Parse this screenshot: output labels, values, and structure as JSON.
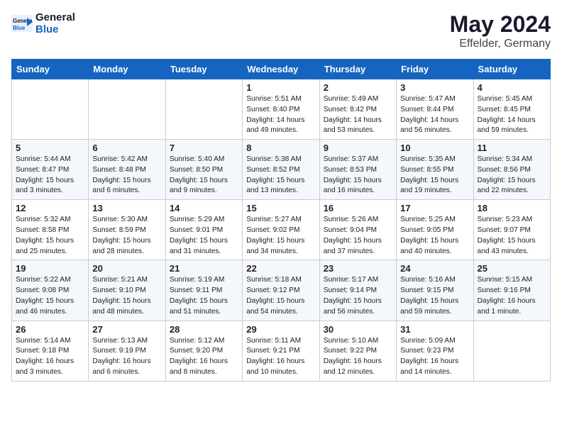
{
  "logo": {
    "line1": "General",
    "line2": "Blue"
  },
  "title": "May 2024",
  "location": "Effelder, Germany",
  "weekdays": [
    "Sunday",
    "Monday",
    "Tuesday",
    "Wednesday",
    "Thursday",
    "Friday",
    "Saturday"
  ],
  "weeks": [
    [
      {
        "day": "",
        "info": ""
      },
      {
        "day": "",
        "info": ""
      },
      {
        "day": "",
        "info": ""
      },
      {
        "day": "1",
        "info": "Sunrise: 5:51 AM\nSunset: 8:40 PM\nDaylight: 14 hours\nand 49 minutes."
      },
      {
        "day": "2",
        "info": "Sunrise: 5:49 AM\nSunset: 8:42 PM\nDaylight: 14 hours\nand 53 minutes."
      },
      {
        "day": "3",
        "info": "Sunrise: 5:47 AM\nSunset: 8:44 PM\nDaylight: 14 hours\nand 56 minutes."
      },
      {
        "day": "4",
        "info": "Sunrise: 5:45 AM\nSunset: 8:45 PM\nDaylight: 14 hours\nand 59 minutes."
      }
    ],
    [
      {
        "day": "5",
        "info": "Sunrise: 5:44 AM\nSunset: 8:47 PM\nDaylight: 15 hours\nand 3 minutes."
      },
      {
        "day": "6",
        "info": "Sunrise: 5:42 AM\nSunset: 8:48 PM\nDaylight: 15 hours\nand 6 minutes."
      },
      {
        "day": "7",
        "info": "Sunrise: 5:40 AM\nSunset: 8:50 PM\nDaylight: 15 hours\nand 9 minutes."
      },
      {
        "day": "8",
        "info": "Sunrise: 5:38 AM\nSunset: 8:52 PM\nDaylight: 15 hours\nand 13 minutes."
      },
      {
        "day": "9",
        "info": "Sunrise: 5:37 AM\nSunset: 8:53 PM\nDaylight: 15 hours\nand 16 minutes."
      },
      {
        "day": "10",
        "info": "Sunrise: 5:35 AM\nSunset: 8:55 PM\nDaylight: 15 hours\nand 19 minutes."
      },
      {
        "day": "11",
        "info": "Sunrise: 5:34 AM\nSunset: 8:56 PM\nDaylight: 15 hours\nand 22 minutes."
      }
    ],
    [
      {
        "day": "12",
        "info": "Sunrise: 5:32 AM\nSunset: 8:58 PM\nDaylight: 15 hours\nand 25 minutes."
      },
      {
        "day": "13",
        "info": "Sunrise: 5:30 AM\nSunset: 8:59 PM\nDaylight: 15 hours\nand 28 minutes."
      },
      {
        "day": "14",
        "info": "Sunrise: 5:29 AM\nSunset: 9:01 PM\nDaylight: 15 hours\nand 31 minutes."
      },
      {
        "day": "15",
        "info": "Sunrise: 5:27 AM\nSunset: 9:02 PM\nDaylight: 15 hours\nand 34 minutes."
      },
      {
        "day": "16",
        "info": "Sunrise: 5:26 AM\nSunset: 9:04 PM\nDaylight: 15 hours\nand 37 minutes."
      },
      {
        "day": "17",
        "info": "Sunrise: 5:25 AM\nSunset: 9:05 PM\nDaylight: 15 hours\nand 40 minutes."
      },
      {
        "day": "18",
        "info": "Sunrise: 5:23 AM\nSunset: 9:07 PM\nDaylight: 15 hours\nand 43 minutes."
      }
    ],
    [
      {
        "day": "19",
        "info": "Sunrise: 5:22 AM\nSunset: 9:08 PM\nDaylight: 15 hours\nand 46 minutes."
      },
      {
        "day": "20",
        "info": "Sunrise: 5:21 AM\nSunset: 9:10 PM\nDaylight: 15 hours\nand 48 minutes."
      },
      {
        "day": "21",
        "info": "Sunrise: 5:19 AM\nSunset: 9:11 PM\nDaylight: 15 hours\nand 51 minutes."
      },
      {
        "day": "22",
        "info": "Sunrise: 5:18 AM\nSunset: 9:12 PM\nDaylight: 15 hours\nand 54 minutes."
      },
      {
        "day": "23",
        "info": "Sunrise: 5:17 AM\nSunset: 9:14 PM\nDaylight: 15 hours\nand 56 minutes."
      },
      {
        "day": "24",
        "info": "Sunrise: 5:16 AM\nSunset: 9:15 PM\nDaylight: 15 hours\nand 59 minutes."
      },
      {
        "day": "25",
        "info": "Sunrise: 5:15 AM\nSunset: 9:16 PM\nDaylight: 16 hours\nand 1 minute."
      }
    ],
    [
      {
        "day": "26",
        "info": "Sunrise: 5:14 AM\nSunset: 9:18 PM\nDaylight: 16 hours\nand 3 minutes."
      },
      {
        "day": "27",
        "info": "Sunrise: 5:13 AM\nSunset: 9:19 PM\nDaylight: 16 hours\nand 6 minutes."
      },
      {
        "day": "28",
        "info": "Sunrise: 5:12 AM\nSunset: 9:20 PM\nDaylight: 16 hours\nand 8 minutes."
      },
      {
        "day": "29",
        "info": "Sunrise: 5:11 AM\nSunset: 9:21 PM\nDaylight: 16 hours\nand 10 minutes."
      },
      {
        "day": "30",
        "info": "Sunrise: 5:10 AM\nSunset: 9:22 PM\nDaylight: 16 hours\nand 12 minutes."
      },
      {
        "day": "31",
        "info": "Sunrise: 5:09 AM\nSunset: 9:23 PM\nDaylight: 16 hours\nand 14 minutes."
      },
      {
        "day": "",
        "info": ""
      }
    ]
  ]
}
